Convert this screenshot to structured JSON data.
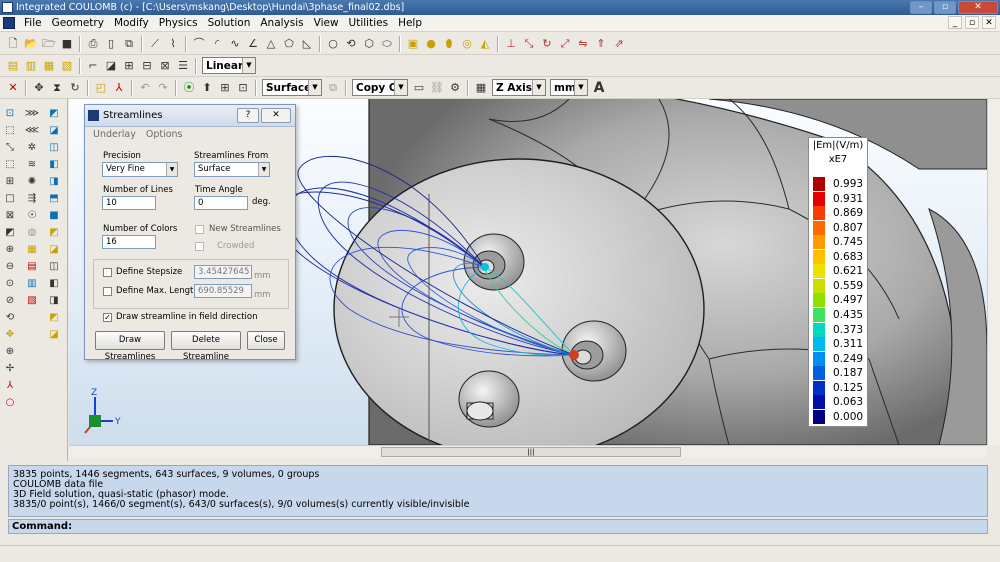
{
  "window": {
    "title": "Integrated COULOMB (c) - [C:\\Users\\mskang\\Desktop\\Hundai\\3phase_final02.dbs]"
  },
  "menu": [
    "File",
    "Geometry",
    "Modify",
    "Physics",
    "Solution",
    "Analysis",
    "View",
    "Utilities",
    "Help"
  ],
  "toolbar": {
    "interp": "Linear",
    "surface": "Surface",
    "copy": "Copy On",
    "axis": "Z Axis",
    "unit": "mm",
    "text_tool": "A"
  },
  "dialog": {
    "title": "Streamlines",
    "help": "?",
    "menu": [
      "Underlay",
      "Options"
    ],
    "precision_label": "Precision",
    "precision_value": "Very Fine",
    "from_label": "Streamlines From",
    "from_value": "Surface",
    "num_lines_label": "Number of Lines",
    "num_lines_value": "10",
    "time_angle_label": "Time Angle",
    "time_angle_value": "0",
    "deg_unit": "deg.",
    "num_colors_label": "Number of Colors",
    "num_colors_value": "16",
    "new_streamlines": "New Streamlines",
    "crowded": "Crowded",
    "define_stepsize": "Define Stepsize",
    "stepsize_value": "3.45427645",
    "define_max_length": "Define Max. Length",
    "max_length_value": "690.85529",
    "mm_unit": "mm",
    "draw_in_field_dir": "Draw streamline in field direction",
    "buttons": {
      "draw": "Draw Streamlines",
      "delete": "Delete Streamline",
      "close": "Close"
    }
  },
  "legend": {
    "header": "|Em|(V/m)",
    "scale": "xE7",
    "values": [
      "0.993",
      "0.931",
      "0.869",
      "0.807",
      "0.745",
      "0.683",
      "0.621",
      "0.559",
      "0.497",
      "0.435",
      "0.373",
      "0.311",
      "0.249",
      "0.187",
      "0.125",
      "0.063",
      "0.000"
    ],
    "colors": [
      "#b00000",
      "#e60000",
      "#ff3a00",
      "#ff6a00",
      "#ff9a00",
      "#ffc000",
      "#f0e000",
      "#c8e000",
      "#8fe000",
      "#40e060",
      "#00d8c0",
      "#00b8f0",
      "#0090f0",
      "#0060e0",
      "#0030c8",
      "#0010a8",
      "#000080"
    ]
  },
  "axis_triad": {
    "z": "Z",
    "y": "Y"
  },
  "output": {
    "lines": [
      "3835 points,   1446 segments,   643 surfaces,   9 volumes,   0 groups",
      "COULOMB data file",
      "3D Field solution, quasi-static (phasor) mode.",
      "3835/0 point(s), 1466/0 segment(s), 643/0 surfaces(s), 9/0 volumes(s) currently visible/invisible"
    ],
    "command_label": "Command:"
  }
}
